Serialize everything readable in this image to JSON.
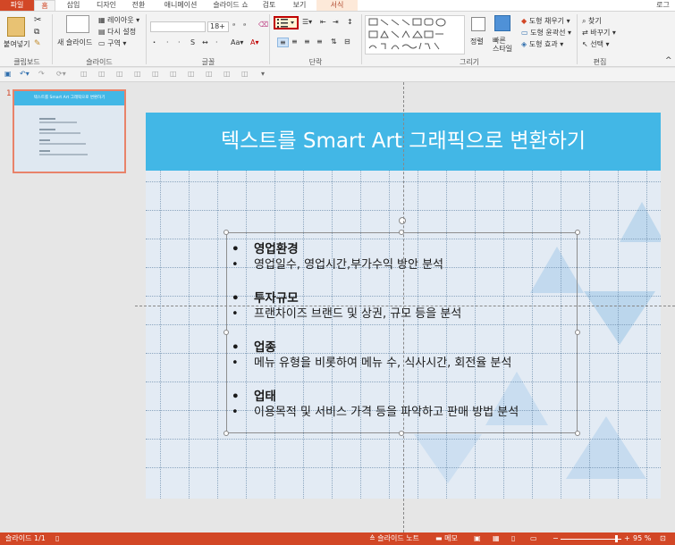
{
  "tabs": [
    {
      "label": "파일"
    },
    {
      "label": "홈"
    },
    {
      "label": "삽입"
    },
    {
      "label": "디자인"
    },
    {
      "label": "전환"
    },
    {
      "label": "애니메이션"
    },
    {
      "label": "슬라이드 쇼"
    },
    {
      "label": "검토"
    },
    {
      "label": "보기"
    },
    {
      "label": "서식"
    },
    {
      "label": "로그"
    }
  ],
  "ribbon": {
    "clipboard": {
      "paste": "붙여넣기",
      "group": "클립보드"
    },
    "slides": {
      "new_slide": "새 슬라이드",
      "layout": "레이아웃",
      "reset": "다시 설정",
      "section": "구역",
      "group": "슬라이드"
    },
    "font": {
      "font_name": "",
      "font_size": "18+",
      "group": "글꼴"
    },
    "paragraph": {
      "group": "단락"
    },
    "drawing": {
      "arrange": "정렬",
      "quick_styles": "빠른 스타일",
      "shape_fill": "도형 채우기",
      "shape_outline": "도형 윤곽선",
      "shape_effects": "도형 효과",
      "group": "그리기"
    },
    "editing": {
      "find": "찾기",
      "replace": "바꾸기",
      "select": "선택",
      "group": "편집"
    }
  },
  "thumbnail": {
    "number": "1",
    "title": "텍스트를 Smart Art 그래픽으로 변환하기"
  },
  "slide": {
    "title": "텍스트를 Smart Art 그래픽으로 변환하기",
    "bullets": [
      {
        "head": "영업환경",
        "detail": "영업일수, 영업시간,부가수익 방안 분석"
      },
      {
        "head": "투자규모",
        "detail": "프랜차이즈 브랜드 및 상권, 규모 등을 분석"
      },
      {
        "head": "업종",
        "detail": "메뉴 유형을 비롯하여 메뉴 수, 식사시간, 회전율 분석"
      },
      {
        "head": "업태",
        "detail": "이용목적 및 서비스 가격 등을 파악하고 판매 방법 분석"
      }
    ],
    "bullet_char": "•"
  },
  "status": {
    "slide": "슬라이드 1/1",
    "notes": "슬라이드 노트",
    "memo": "메모",
    "zoom": "95 %"
  },
  "colors": {
    "accent": "#d24726",
    "title_bar": "#42b7e6",
    "slide_bg": "#e3ebf4"
  }
}
